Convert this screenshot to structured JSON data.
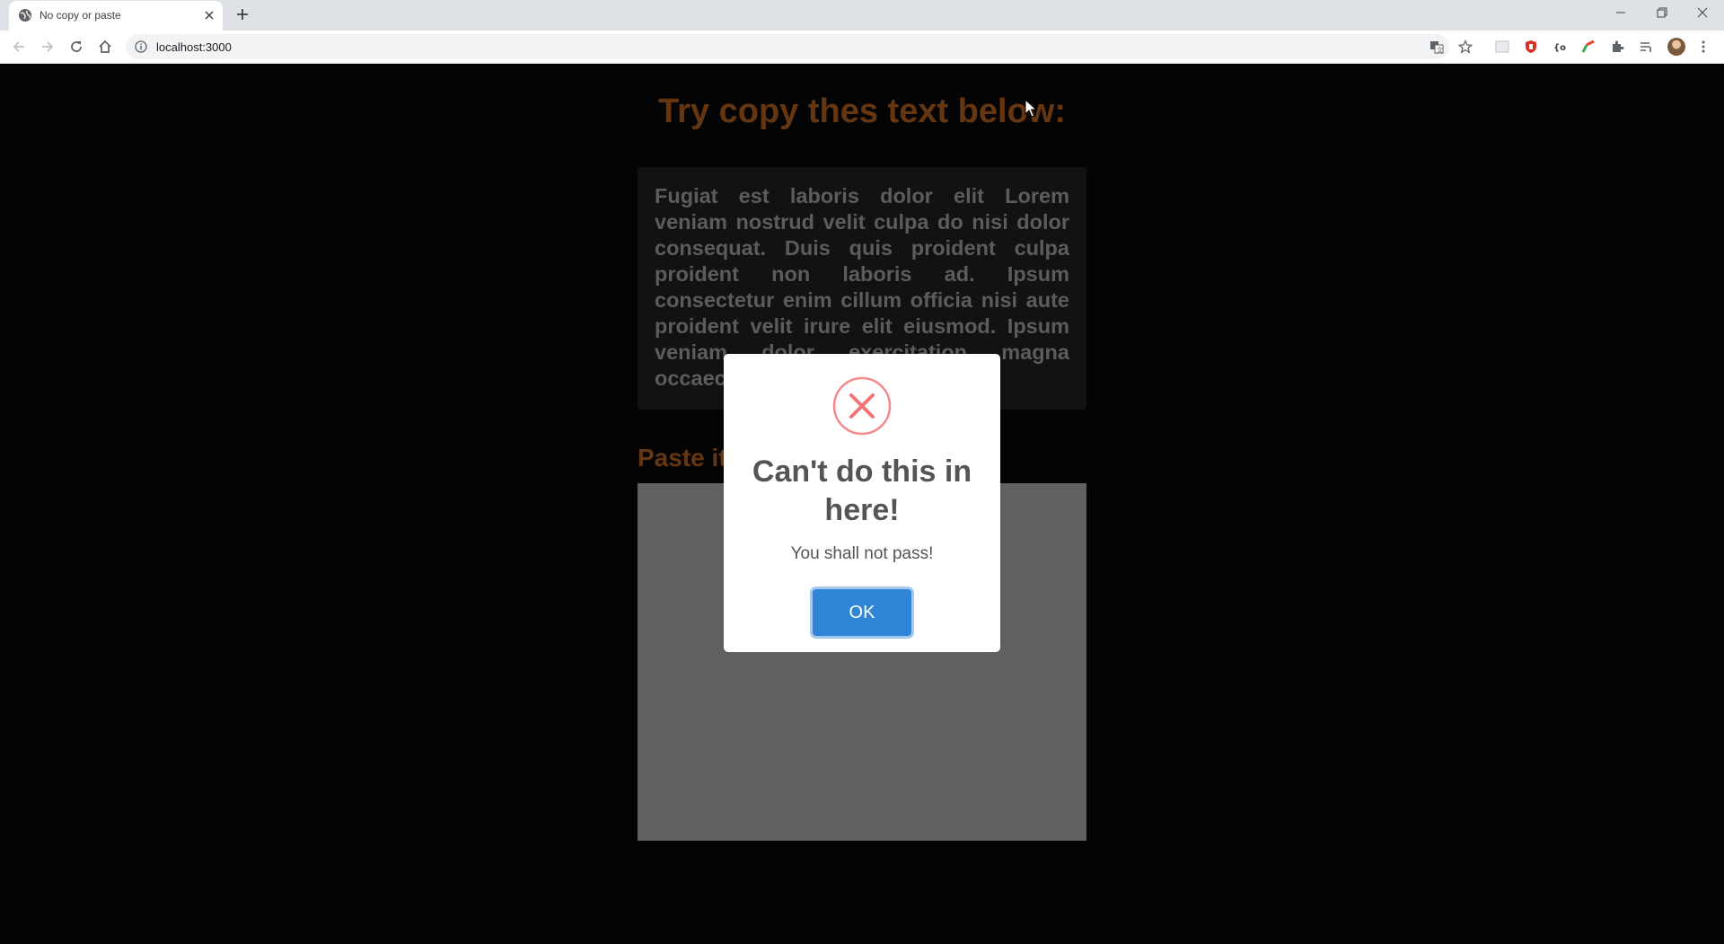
{
  "browser": {
    "tab_title": "No copy or paste",
    "url": "localhost:3000"
  },
  "page": {
    "heading": "Try copy thes text below:",
    "body_text": "Fugiat est laboris dolor elit Lorem veniam nostrud velit culpa do nisi dolor consequat. Duis quis proident culpa proident non laboris ad. Ipsum consectetur enim cillum officia nisi aute proident velit irure elit eiusmod. Ipsum veniam dolor exercitation magna occaecat mollit e",
    "paste_label": "Paste it"
  },
  "modal": {
    "icon": "error-x-icon",
    "title": "Can't do this in here!",
    "text": "You shall not pass!",
    "ok_label": "OK",
    "accent_color": "#3085d6",
    "icon_color": "#f27474"
  },
  "colors": {
    "heading": "#a85a1c",
    "background": "#090807"
  }
}
